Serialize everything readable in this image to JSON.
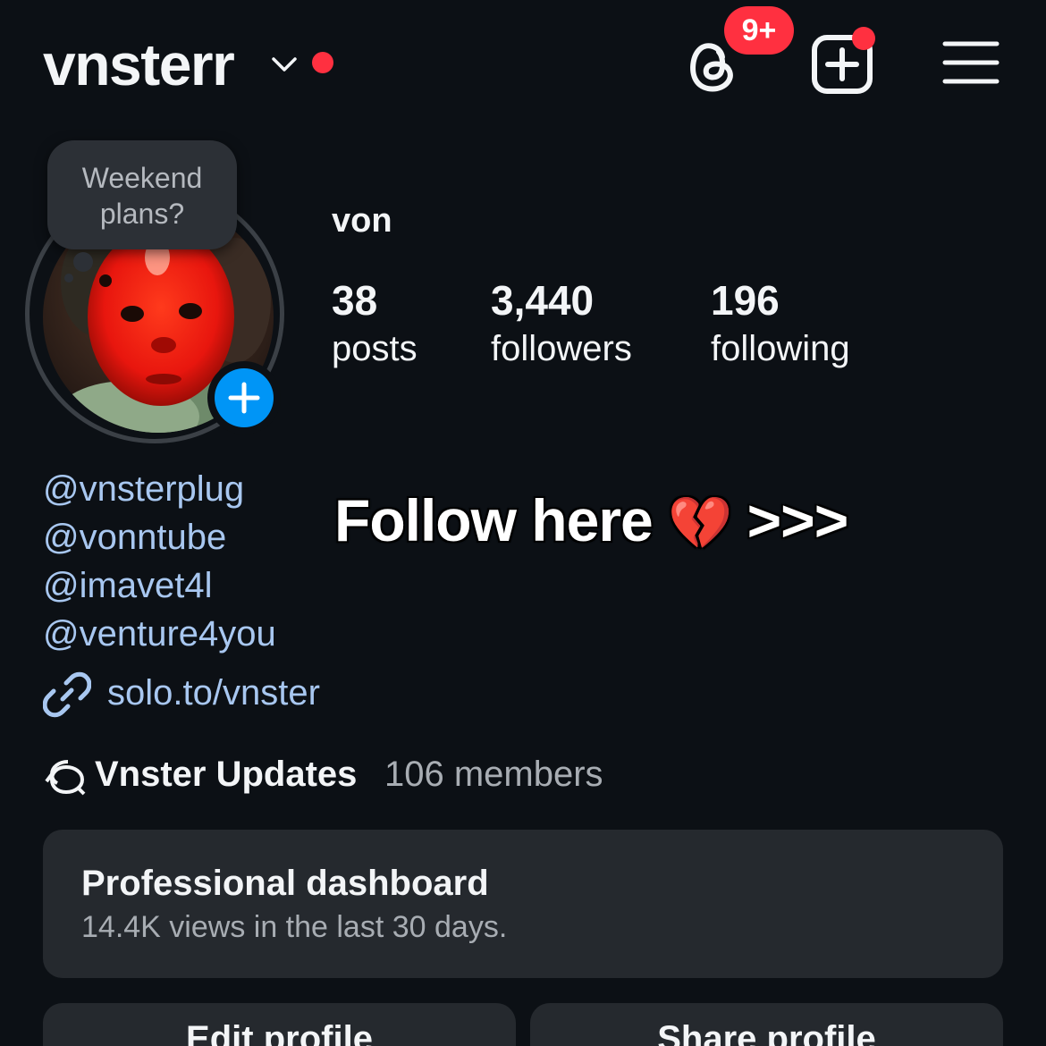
{
  "header": {
    "username": "vnsterr",
    "threads_badge": "9+"
  },
  "note": {
    "text_line1": "Weekend",
    "text_line2": "plans?"
  },
  "profile": {
    "display_name": "von",
    "stats": [
      {
        "value": "38",
        "label": "posts"
      },
      {
        "value": "3,440",
        "label": "followers"
      },
      {
        "value": "196",
        "label": "following"
      }
    ]
  },
  "bio": {
    "mentions": [
      "@vnsterplug",
      "@vonntube",
      "@imavet4l",
      "@venture4you"
    ],
    "link": "solo.to/vnster"
  },
  "overlay": {
    "caption": "Follow here",
    "emoji": "💔",
    "arrows": ">>>"
  },
  "channel": {
    "name": "Vnster Updates",
    "members": "106 members"
  },
  "dashboard": {
    "title": "Professional dashboard",
    "subtitle": "14.4K views in the last 30 days."
  },
  "buttons": {
    "edit": "Edit profile",
    "share": "Share profile"
  },
  "colors": {
    "background": "#0c1015",
    "link": "#a8c7f0",
    "notification": "#ff3040",
    "accent": "#0095f6",
    "card": "#25292e"
  }
}
